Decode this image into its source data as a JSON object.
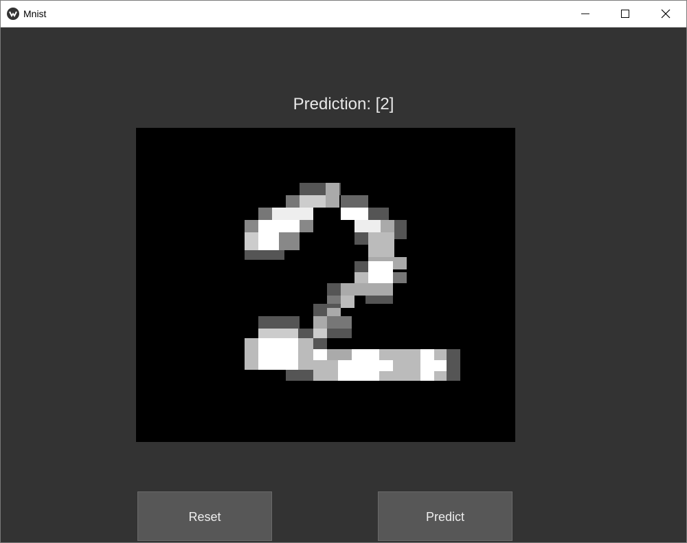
{
  "window": {
    "title": "Mnist"
  },
  "prediction": {
    "text": "Prediction: [2]"
  },
  "buttons": {
    "reset": "Reset",
    "predict": "Predict"
  },
  "canvas": {
    "digit_drawn": "2"
  }
}
